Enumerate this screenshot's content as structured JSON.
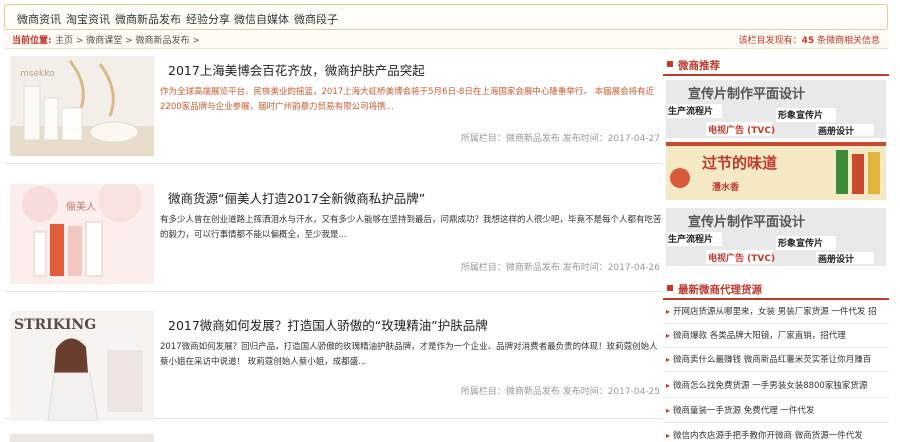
{
  "topnav": {
    "items": [
      "微商资讯",
      "淘宝资讯",
      "微商新品发布",
      "经验分享",
      "微信自媒体",
      "微商段子"
    ]
  },
  "crumb": {
    "current": "当前位置:",
    "path": "主页 > 微商课堂 > 微商新品发布 >",
    "count_prefix": "该栏目发现有：",
    "count_value": "45",
    "count_suffix": "条微商相关信息"
  },
  "articles": [
    {
      "title": "2017上海美博会百花齐放，微商护肤产品突起",
      "summary": "作为全球高端展览平台、民族美业的摇篮，2017上海大虹桥美博会将于5月6日-8日在上海国家会展中心隆重举行。 本届展会将有近2200家品牌与企业参展，届时广州韵慕力贸易有限公司将携...",
      "meta": "所属栏目：微商新品发布 发布时间：2017-04-27",
      "thumb_text": "msekko"
    },
    {
      "title": "微商货源“俪美人打造2017全新微商私护品牌”",
      "summary": "有多少人曾在创业道路上挥洒泪水与汗水，又有多少人能够在坚持到最后，问鼎成功？我想这样的人很少吧，毕竟不是每个人都有吃苦的毅力，可以行事情都不能以偏概全，至少我是...",
      "meta": "所属栏目：微商新品发布 发布时间：2017-04-26",
      "thumb_text": "俪美人"
    },
    {
      "title": "2017微商如何发展？打造国人骄傲的“玫瑰精油”护肤品牌",
      "summary": "2017微商如何发展？回归产品，打造国人骄傲的玫瑰精油护肤品牌，才是作为一个企业、品牌对消费者最负责的体现！玫莉蔻创始人蔡小姐在采访中说道！ 玫莉蔻创始人蔡小姐，成都盛...",
      "meta": "所属栏目：微商新品发布 发布时间：2017-04-25",
      "thumb_text": "STRIKING"
    }
  ],
  "sidebar": {
    "rec_title": "微商推荐",
    "ads": [
      {
        "title": "宣传片制作平面设计",
        "labels": [
          "生产流程片",
          "形象宣传片",
          "电视广告 (TVC)",
          "画册设计"
        ]
      },
      {
        "title": "过节的味道",
        "labels": [
          "澧水香"
        ]
      },
      {
        "title": "宣传片制作平面设计",
        "labels": [
          "生产流程片",
          "形象宣传片",
          "电视广告 (TVC)",
          "画册设计"
        ]
      }
    ],
    "list_title": "最新微商代理货源",
    "list": [
      "开网店货源从哪里来，女装 男装厂家货源 一件代发 招",
      "微商爆款 各类品牌大阳镜，厂家直销，招代理",
      "微商卖什么最赚钱 微商新品红薯米芡实茶让你月赚百",
      "微商怎么找免费货源 一手男装女装8800家独家货源",
      "微商童装一手货源 免费代理 一件代发",
      "微信内衣店源手把手教你开微商 微商货源一件代发"
    ]
  },
  "colors": {
    "accent": "#c0392b",
    "title": "#222222",
    "meta": "#999999"
  }
}
